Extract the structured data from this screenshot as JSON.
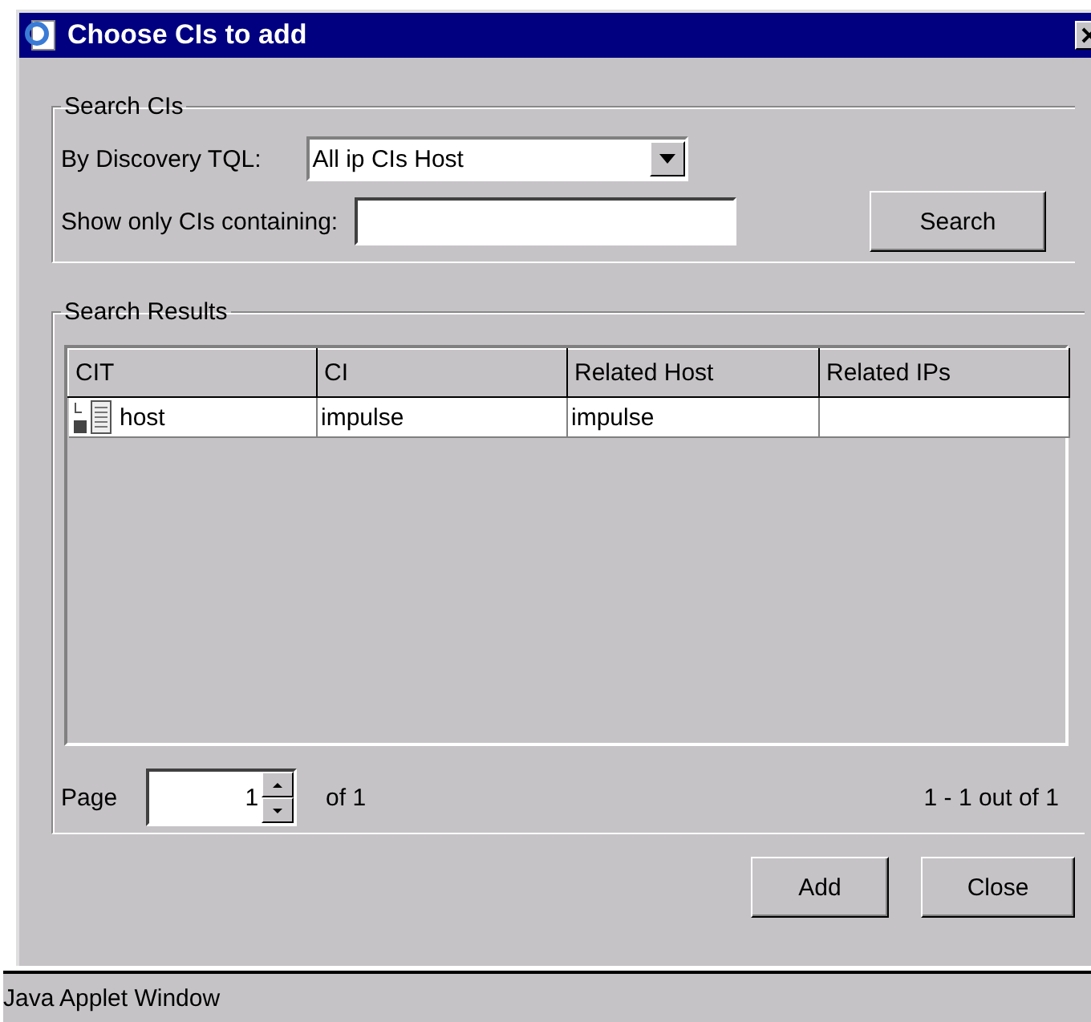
{
  "window": {
    "title": "Choose CIs to add"
  },
  "search_group": {
    "legend": "Search CIs",
    "tql_label": "By Discovery TQL:",
    "tql_value": "All ip CIs Host",
    "filter_label": "Show only CIs containing:",
    "search_button": "Search"
  },
  "results_group": {
    "legend": "Search Results",
    "table": {
      "columns": [
        "CIT",
        "CI",
        "Related Host",
        "Related IPs"
      ],
      "rows": [
        {
          "cells": [
            "host",
            "impulse",
            "impulse",
            ""
          ],
          "selected": false
        }
      ]
    },
    "pagination": {
      "label": "Page",
      "value": "1",
      "of": "of 1",
      "summary": "1 - 1 out of 1"
    }
  },
  "buttons": [
    "Add",
    "Close"
  ],
  "status_bar": "Java Applet Window"
}
